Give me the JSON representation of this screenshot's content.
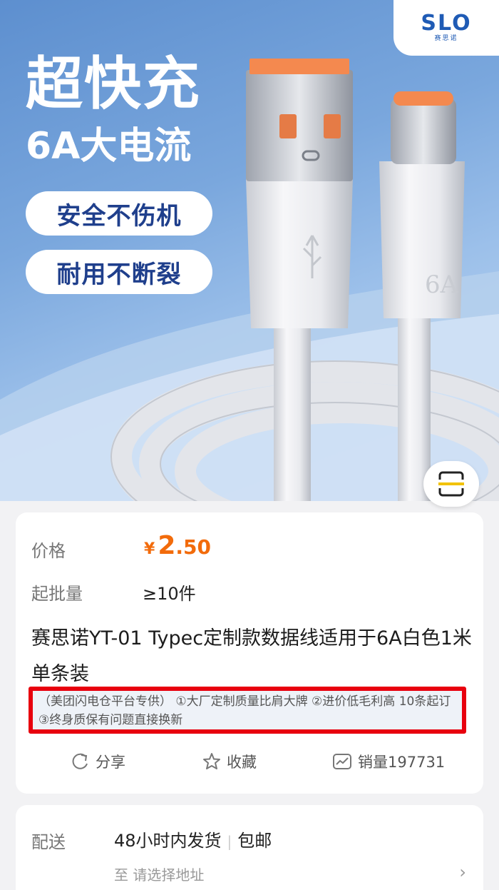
{
  "hero": {
    "brand": {
      "logo_text": "SLO",
      "logo_sub": "赛思诺",
      "registered_mark": "®"
    },
    "headline_line1": "超快充",
    "headline_line2": "6A大电流",
    "feature_pills": [
      "安全不伤机",
      "耐用不断裂"
    ],
    "connector_mark": "6A",
    "colors": {
      "background": "#7aa7dd",
      "pill_text": "#1f3f8c",
      "connector_tip": "#f4894f"
    }
  },
  "product": {
    "price_label": "价格",
    "currency": "¥",
    "price_integer": "2",
    "price_decimal": ".50",
    "moq_label": "起批量",
    "moq_value": "≥10件",
    "title": "赛思诺YT-01 Typec定制款数据线适用于6A白色1米单条装",
    "promo_text": "（美团闪电仓平台专供） ①大厂定制质量比肩大牌 ②进价低毛利高 10条起订 ③终身质保有问题直接换新",
    "accent_color": "#f26b0b",
    "highlight_border_color": "#e8000e"
  },
  "actions": {
    "share": "分享",
    "favorite": "收藏",
    "sales": "销量197731"
  },
  "shipping": {
    "label": "配送",
    "dispatch": "48小时内发货",
    "separator": "|",
    "free_shipping": "包邮",
    "address_prompt": "至 请选择地址",
    "arrow": "›"
  }
}
